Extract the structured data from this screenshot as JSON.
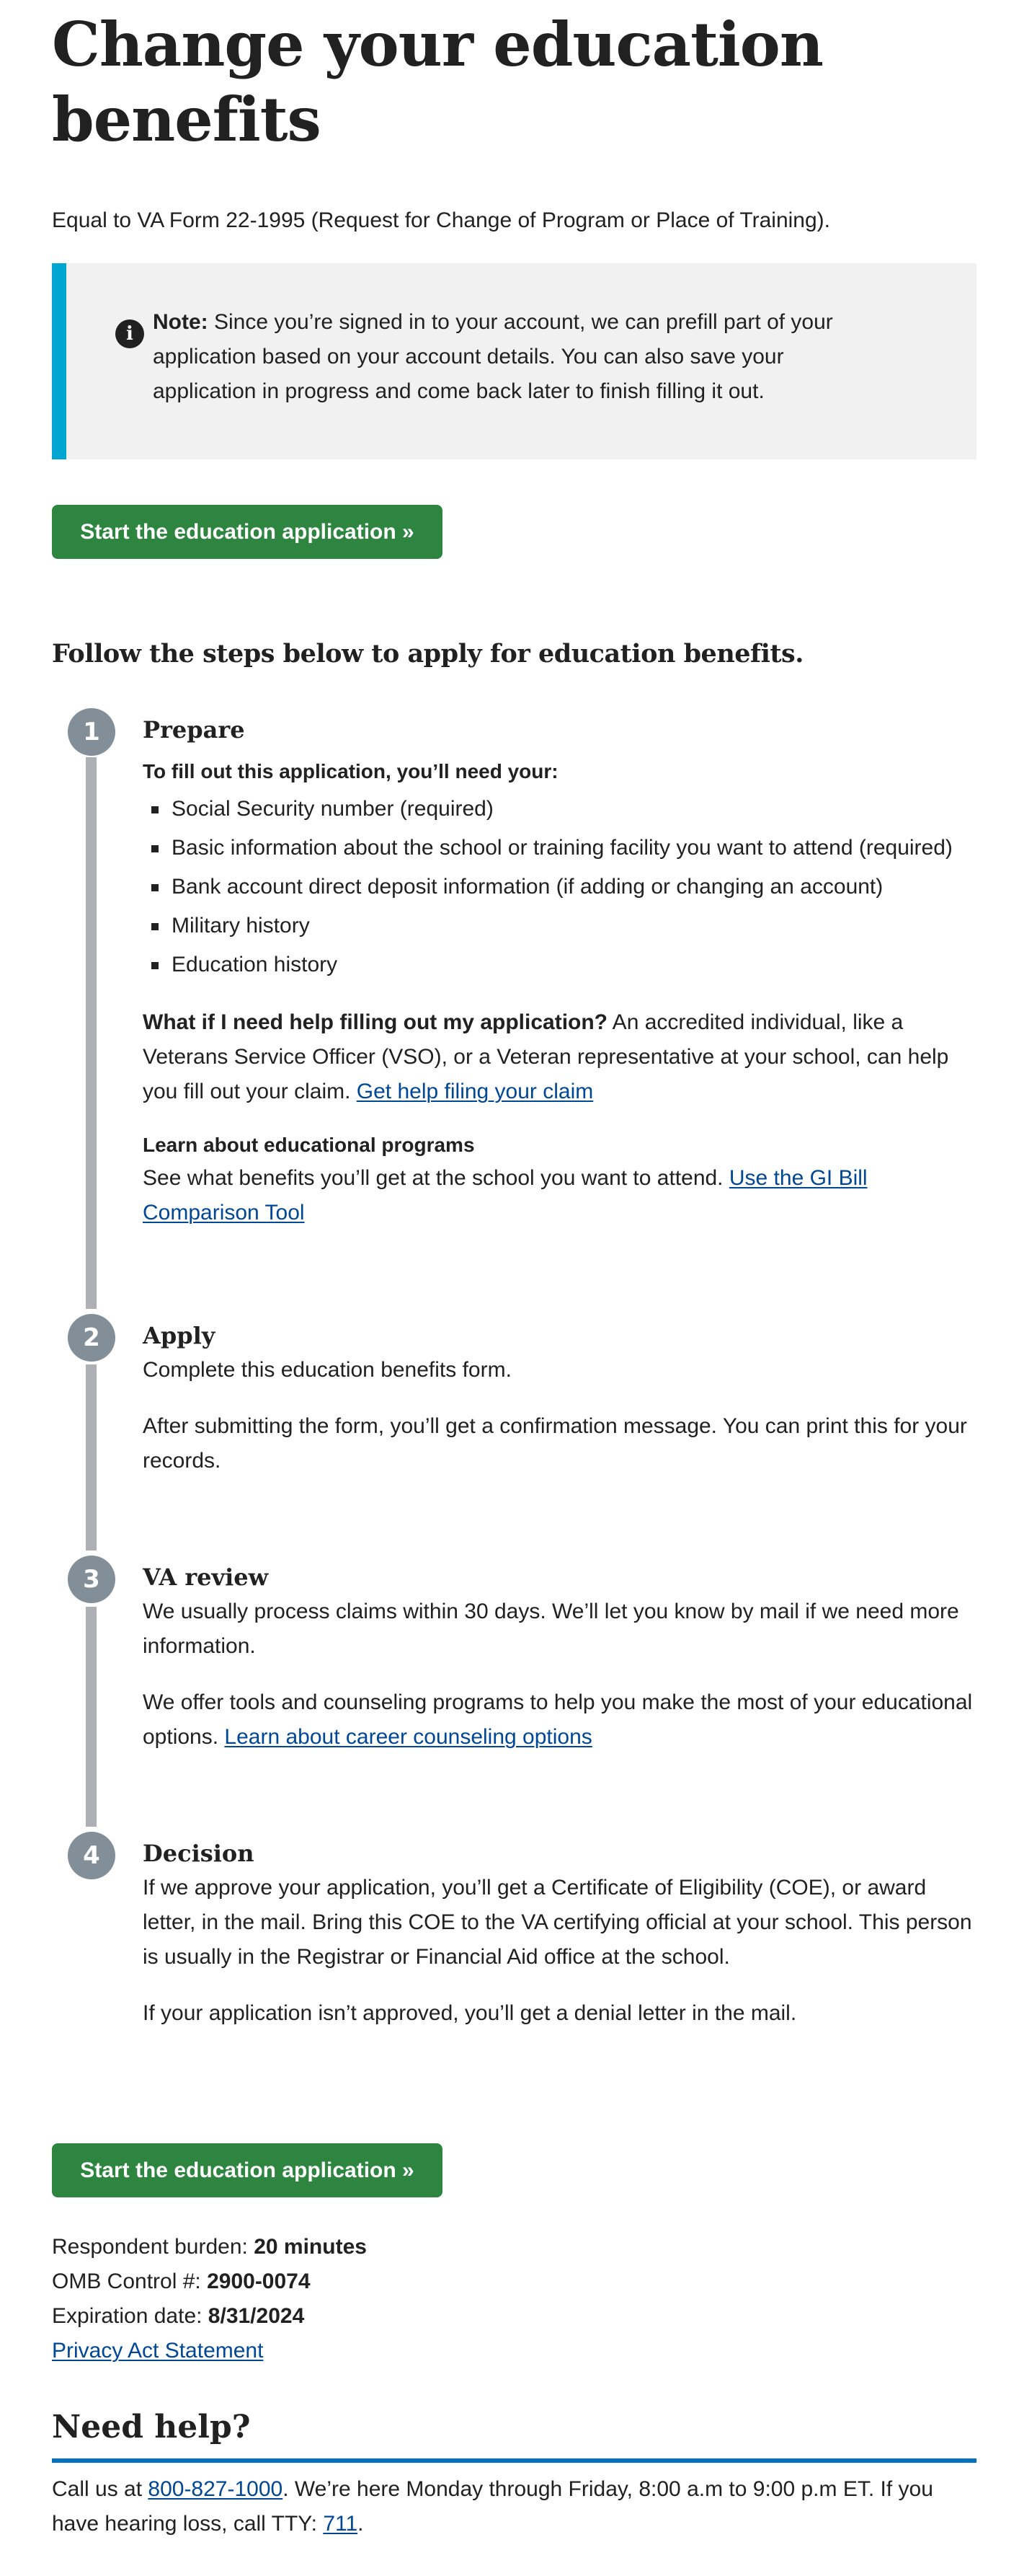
{
  "header": {
    "title": "Change your education benefits",
    "subtitle": "Equal to VA Form 22-1995 (Request for Change of Program or Place of Training)."
  },
  "note": {
    "icon": "info-circle-icon",
    "label": "Note:",
    "text": " Since you’re signed in to your account, we can prefill part of your application based on your account details. You can also save your application in progress and come back later to finish filling it out."
  },
  "actions": {
    "start_label": "Start the education application »"
  },
  "steps_heading": "Follow the steps below to apply for education benefits.",
  "colors": {
    "accent_green": "#2e8540",
    "note_border": "#00a6d2",
    "step_circle": "#828f99",
    "step_bar": "#aeb0b5",
    "link": "#004795",
    "help_rule": "#0071bb"
  },
  "steps": [
    {
      "number": "1",
      "title": "Prepare",
      "needs_heading": "To fill out this application, you’ll need your:",
      "needs": [
        "Social Security number (required)",
        "Basic information about the school or training facility you want to attend (required)",
        "Bank account direct deposit information (if adding or changing an account)",
        "Military history",
        "Education history"
      ],
      "help_question": "What if I need help filling out my application?",
      "help_text": " An accredited individual, like a Veterans Service Officer (VSO), or a Veteran representative at your school, can help you fill out your claim. ",
      "help_link": "Get help filing your claim",
      "programs_heading": "Learn about educational programs",
      "programs_text": "See what benefits you’ll get at the school you want to attend. ",
      "programs_link": "Use the GI Bill Comparison Tool"
    },
    {
      "number": "2",
      "title": "Apply",
      "p1": "Complete this education benefits form.",
      "p2": "After submitting the form, you’ll get a confirmation message. You can print this for your records."
    },
    {
      "number": "3",
      "title": "VA review",
      "p1": "We usually process claims within 30 days. We’ll let you know by mail if we need more information.",
      "p2": "We offer tools and counseling programs to help you make the most of your educational options. ",
      "p2_link": "Learn about career counseling options"
    },
    {
      "number": "4",
      "title": "Decision",
      "p1": "If we approve your application, you’ll get a Certificate of Eligibility (COE), or award letter, in the mail. Bring this COE to the VA certifying official at your school. This person is usually in the Registrar or Financial Aid office at the school.",
      "p2": "If your application isn’t approved, you’ll get a denial letter in the mail."
    }
  ],
  "meta": {
    "burden_label": "Respondent burden: ",
    "burden_value": "20 minutes",
    "omb_label": "OMB Control #: ",
    "omb_value": "2900-0074",
    "expiration_label": "Expiration date: ",
    "expiration_value": "8/31/2024",
    "privacy_link": "Privacy Act Statement"
  },
  "help": {
    "heading": "Need help?",
    "text_before": "Call us at ",
    "phone": "800-827-1000",
    "text_middle": ". We’re here Monday through Friday, 8:00 a.m to 9:00 p.m ET. If you have hearing loss, call TTY: ",
    "tty": "711",
    "text_after": "."
  }
}
